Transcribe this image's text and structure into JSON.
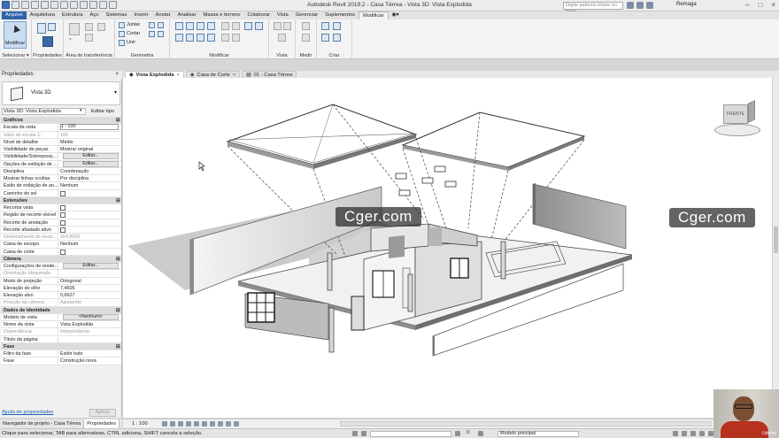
{
  "app": {
    "title": "Autodesk Revit 2019.2 - Casa Térrea - Vista 3D: Vista Explodida",
    "search_placeholder": "Digite palavra-chave ou frase",
    "user": "Remaga"
  },
  "ribbon_tabs": [
    "Arquivo",
    "Arquitetura",
    "Estrutura",
    "Aço",
    "Sistemas",
    "Inserir",
    "Anotar",
    "Analisar",
    "Massa e terreno",
    "Colaborar",
    "Vista",
    "Gerenciar",
    "Suplementos",
    "Modificar"
  ],
  "ribbon": {
    "modify_button": "Modificar",
    "group_labels": [
      "Selecionar ▾",
      "Propriedades",
      "Área de transferência",
      "Geometria",
      "Modificar",
      "Vista",
      "Medir",
      "Criar"
    ],
    "geometry_items": [
      "Juntar",
      "Cortar",
      "Unir"
    ]
  },
  "properties": {
    "header": "Propriedades",
    "close": "×",
    "type_name": "Vista 3D",
    "type_dropdown": "▾",
    "selector": "Vista 3D: Vista Explodida",
    "selector_dropdown": "▾",
    "edit_type": "Editar tipo",
    "help_link": "Ajuda de propriedades",
    "apply": "Aplicar",
    "rows": [
      {
        "section": "Gráficos"
      },
      {
        "k": "Escala da vista",
        "v": "1 : 100",
        "input": true
      },
      {
        "k": "Valor de escala   1:",
        "v": "100",
        "dim": true
      },
      {
        "k": "Nível de detalhe",
        "v": "Médio"
      },
      {
        "k": "Visibilidade de peças",
        "v": "Mostrar original"
      },
      {
        "k": "Visibilidade/Sobreposiç...",
        "v": "Editar...",
        "button": true
      },
      {
        "k": "Opções de exibição de ...",
        "v": "Editar...",
        "button": true
      },
      {
        "k": "Disciplina",
        "v": "Coordenação"
      },
      {
        "k": "Mostrar linhas ocultas",
        "v": "Por disciplina"
      },
      {
        "k": "Estilo de exibição de an...",
        "v": "Nenhum"
      },
      {
        "k": "Caminho do sol",
        "v": "",
        "check": true
      },
      {
        "section": "Extensões"
      },
      {
        "k": "Recortar vista",
        "v": "",
        "check": true
      },
      {
        "k": "Região de recorte visível",
        "v": "",
        "check": true
      },
      {
        "k": "Recorte de anotação",
        "v": "",
        "check": true
      },
      {
        "k": "Recorte afastado ativo",
        "v": "",
        "check": true
      },
      {
        "k": "Deslocamento de recor...",
        "v": "304,8000",
        "dim": true
      },
      {
        "k": "Caixa de escopo",
        "v": "Nenhum"
      },
      {
        "k": "Caixa de corte",
        "v": "",
        "check": true
      },
      {
        "section": "Câmera"
      },
      {
        "k": "Configurações de rende...",
        "v": "Editar...",
        "button": true
      },
      {
        "k": "Orientação bloqueada",
        "v": "",
        "dim": true
      },
      {
        "k": "Modo de projeção",
        "v": "Ortogonal"
      },
      {
        "k": "Elevação do olho",
        "v": "7,4605"
      },
      {
        "k": "Elevação alvo",
        "v": "0,6627"
      },
      {
        "k": "Posição da câmera",
        "v": "Ajustando",
        "dim": true
      },
      {
        "section": "Dados de identidade"
      },
      {
        "k": "Modelo de vista",
        "v": "<Nenhum>",
        "button": true
      },
      {
        "k": "Nome da vista",
        "v": "Vista Explodida"
      },
      {
        "k": "Dependência",
        "v": "Independente",
        "dim": true
      },
      {
        "k": "Título da página",
        "v": ""
      },
      {
        "section": "Fase"
      },
      {
        "k": "Filtro da fase",
        "v": "Exibir tudo"
      },
      {
        "k": "Fase",
        "v": "Construção nova"
      }
    ],
    "section_toggle": "⊟"
  },
  "bottom_tabs": [
    "Navegador de projeto - Casa Térrea",
    "Propriedades"
  ],
  "doc_tabs": [
    {
      "label": "Vista Explodida",
      "close": "×"
    },
    {
      "label": "Casa de Corte",
      "close": "×"
    },
    {
      "label": "01 - Casa Térrea",
      "close": ""
    }
  ],
  "viewcube_label": "FRENTE",
  "view_scale": "1 : 100",
  "status": {
    "text": "Clique para selecionar, TAB para alternativas, CTRL adiciona, SHIFT cancela a seleção.",
    "model": "Modelo principal",
    "coords": ":0"
  },
  "watermarks": [
    "Cger.com",
    "Cger.com"
  ],
  "webcam_logo": "Udemy"
}
